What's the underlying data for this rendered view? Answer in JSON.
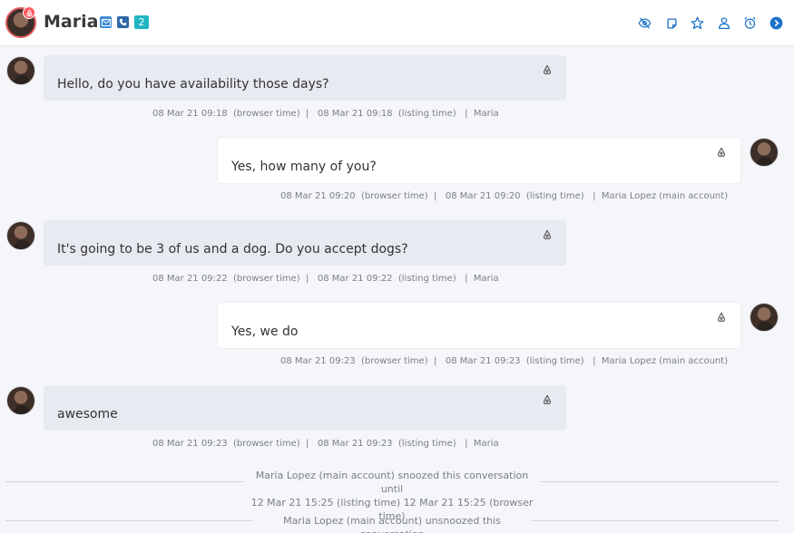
{
  "header": {
    "name": "Maria",
    "unread_count": "2",
    "icons": [
      "email-icon",
      "phone-icon",
      "eye-off-icon",
      "note-icon",
      "star-icon",
      "user-icon",
      "alarm-icon",
      "arrow-right-circle-icon"
    ]
  },
  "messages": [
    {
      "direction": "in",
      "text": "Hello, do you have availability those days?",
      "meta": "08 Mar 21 09:18  (browser time)  |   08 Mar 21 09:18  (listing time)   |  Maria"
    },
    {
      "direction": "out",
      "text": "Yes, how many of you?",
      "meta": "08 Mar 21 09:20  (browser time)  |   08 Mar 21 09:20  (listing time)   |  Maria Lopez (main account)"
    },
    {
      "direction": "in",
      "text": "It's going to be 3 of us and a dog. Do you accept dogs?",
      "meta": "08 Mar 21 09:22  (browser time)  |   08 Mar 21 09:22  (listing time)   |  Maria"
    },
    {
      "direction": "out",
      "text": "Yes, we do",
      "meta": "08 Mar 21 09:23  (browser time)  |   08 Mar 21 09:23  (listing time)   |  Maria Lopez (main account)"
    },
    {
      "direction": "in",
      "text": "awesome",
      "meta": "08 Mar 21 09:23  (browser time)  |   08 Mar 21 09:23  (listing time)   |  Maria"
    }
  ],
  "events": [
    {
      "line1": "Maria Lopez (main account) snoozed this conversation until",
      "line2": "12 Mar 21 15:25 (listing time) 12 Mar 21 15:25 (browser time)"
    },
    {
      "line1": "Maria Lopez (main account) unsnoozed this conversation"
    }
  ],
  "colors": {
    "accent": "#1a73c8",
    "airbnb": "#ff5a5f",
    "badge": "#1fb5c4",
    "incoming_bubble": "#e8eaf1",
    "outgoing_bubble": "#ffffff"
  }
}
